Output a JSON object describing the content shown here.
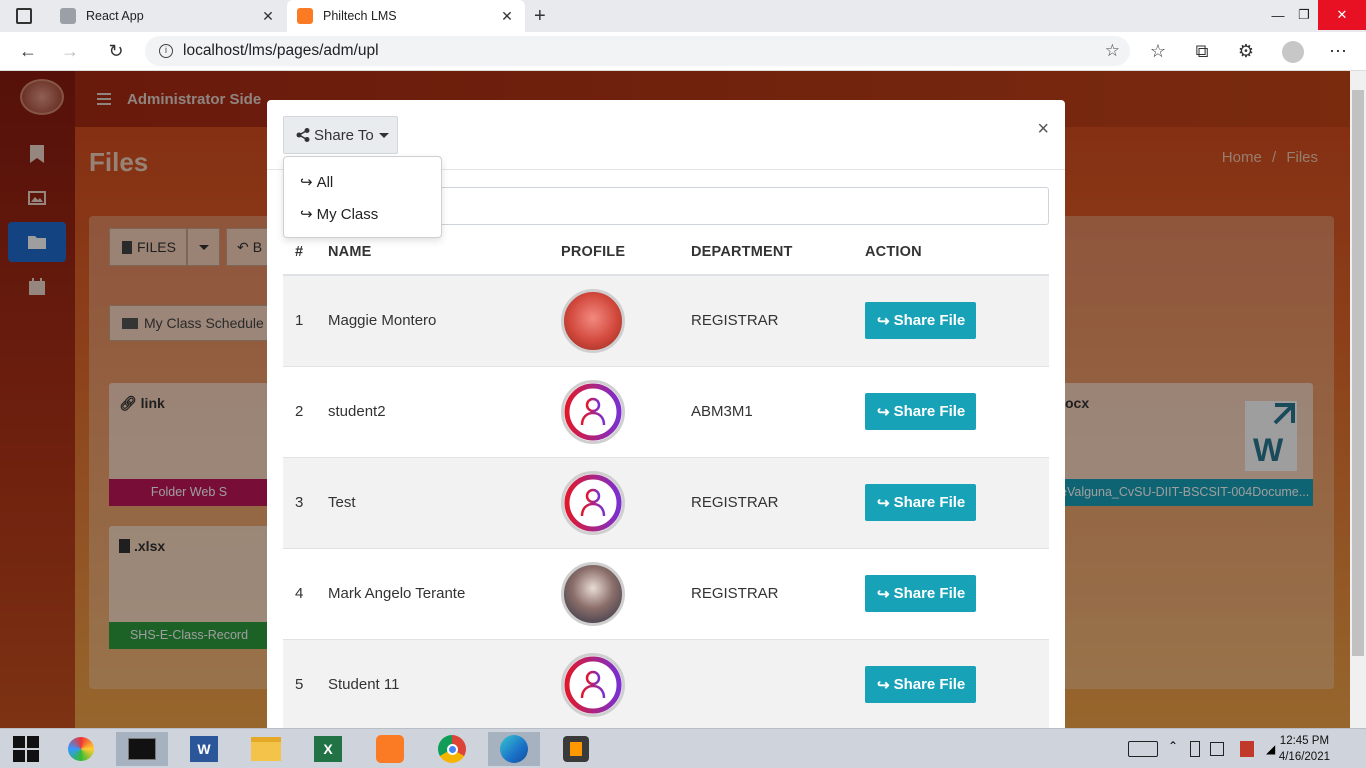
{
  "browser": {
    "tabs": [
      {
        "title": "React App",
        "favicon": "react-icon"
      },
      {
        "title": "Philtech LMS",
        "favicon": "xampp-icon",
        "active": true
      }
    ],
    "url": "localhost/lms/pages/adm/upl"
  },
  "app": {
    "header_title": "Administrator Side",
    "page_title": "Files",
    "breadcrumb": {
      "home": "Home",
      "sep": "/",
      "current": "Files"
    },
    "sidebar_icons": [
      "bookmark-icon",
      "image-icon",
      "folder-icon",
      "calendar-icon"
    ],
    "toolbar": {
      "files_label": "FILES",
      "back_label": "B"
    },
    "folder_label": "My Class Schedule",
    "file_cards": [
      {
        "type_label": "link",
        "bar_text": "Folder Web S",
        "bar_color": "#c2185b"
      },
      {
        "type_label": ".xlsx",
        "bar_text": "SHS-E-Class-Record",
        "bar_color": "#2e9e3e"
      },
      {
        "type_label": "ocx",
        "bar_text": "eValguna_CvSU-DIIT-BSCSIT-004Docume...",
        "bar_color": "#17a2b8"
      }
    ]
  },
  "modal": {
    "share_to_label": "Share To",
    "close_label": "×",
    "dropdown": [
      "All",
      "My Class"
    ],
    "columns": [
      "#",
      "NAME",
      "PROFILE",
      "DEPARTMENT",
      "ACTION"
    ],
    "rows": [
      {
        "num": "1",
        "name": "Maggie Montero",
        "avatar": "photo-red",
        "department": "REGISTRAR",
        "action": "Share File"
      },
      {
        "num": "2",
        "name": "student2",
        "avatar": "default-user",
        "department": "ABM3M1",
        "action": "Share File"
      },
      {
        "num": "3",
        "name": "Test",
        "avatar": "default-user",
        "department": "REGISTRAR",
        "action": "Share File"
      },
      {
        "num": "4",
        "name": "Mark Angelo Terante",
        "avatar": "photo-group",
        "department": "REGISTRAR",
        "action": "Share File"
      },
      {
        "num": "5",
        "name": "Student 11",
        "avatar": "default-user",
        "department": "",
        "action": "Share File"
      }
    ],
    "accent_color": "#17a2b8"
  },
  "taskbar": {
    "time": "12:45 PM",
    "date": "4/16/2021"
  }
}
